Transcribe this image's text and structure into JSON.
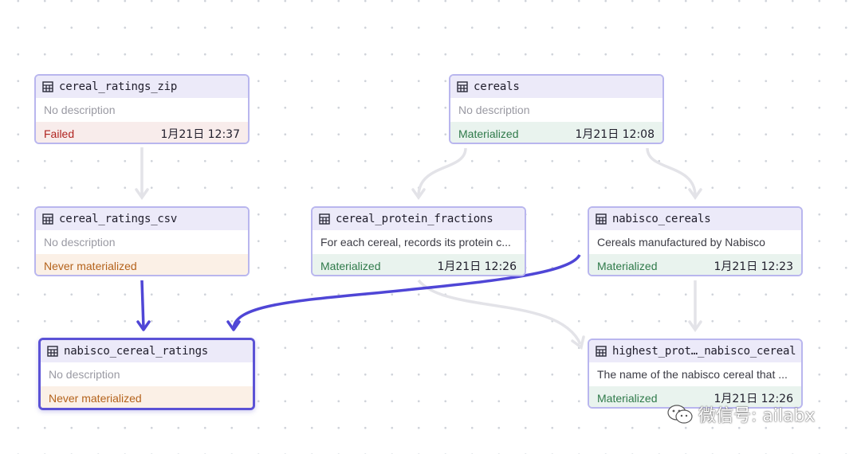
{
  "nodes": [
    {
      "name": "cereal_ratings_zip",
      "description": "No description",
      "status": "Failed",
      "time": "1月21日 12:37"
    },
    {
      "name": "cereals",
      "description": "No description",
      "status": "Materialized",
      "time": "1月21日 12:08"
    },
    {
      "name": "cereal_ratings_csv",
      "description": "No description",
      "status": "Never materialized",
      "time": ""
    },
    {
      "name": "cereal_protein_fractions",
      "description": "For each cereal, records its protein c...",
      "status": "Materialized",
      "time": "1月21日 12:26"
    },
    {
      "name": "nabisco_cereals",
      "description": "Cereals manufactured by Nabisco",
      "status": "Materialized",
      "time": "1月21日 12:23"
    },
    {
      "name": "nabisco_cereal_ratings",
      "description": "No description",
      "status": "Never materialized",
      "time": ""
    },
    {
      "name": "highest_prot…_nabisco_cereal",
      "description": "The name of the nabisco cereal that ...",
      "status": "Materialized",
      "time": "1月21日 12:26"
    }
  ],
  "colors": {
    "edge": "#e3e3e8",
    "edge_highlight": "#4f46d6",
    "node_border": "#b9b6ee",
    "selected_border": "#5b52d6",
    "failed": "#b02420",
    "materialized": "#2f7a4a",
    "never": "#b4621b"
  },
  "icons": {
    "node": "table-icon",
    "watermark": "wechat-icon"
  },
  "watermark": {
    "text": "微信号: ailabx"
  }
}
